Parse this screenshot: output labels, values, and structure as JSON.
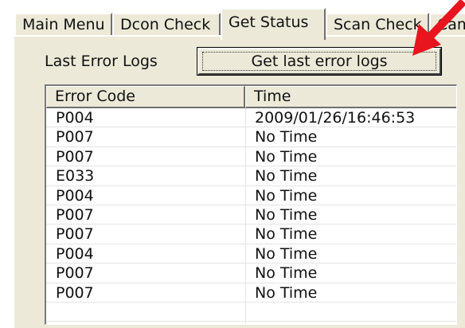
{
  "tabs": [
    {
      "label": "Main Menu"
    },
    {
      "label": "Dcon Check"
    },
    {
      "label": "Get Status"
    },
    {
      "label": "Scan Check"
    },
    {
      "label": "Cam"
    }
  ],
  "panel": {
    "logs_label": "Last Error Logs",
    "get_logs_button": "Get last error logs"
  },
  "table": {
    "columns": [
      "Error Code",
      "Time"
    ],
    "rows": [
      {
        "code": "P004",
        "time": "2009/01/26/16:46:53"
      },
      {
        "code": "P007",
        "time": "No Time"
      },
      {
        "code": "P007",
        "time": "No Time"
      },
      {
        "code": "E033",
        "time": "No Time"
      },
      {
        "code": "P004",
        "time": "No Time"
      },
      {
        "code": "P007",
        "time": "No Time"
      },
      {
        "code": "P007",
        "time": "No Time"
      },
      {
        "code": "P004",
        "time": "No Time"
      },
      {
        "code": "P007",
        "time": "No Time"
      },
      {
        "code": "P007",
        "time": "No Time"
      }
    ]
  },
  "colors": {
    "annotation_arrow": "#e8141e",
    "panel_bg": "#ece9d8"
  },
  "icons": {
    "annotation": "red-arrow-icon"
  }
}
